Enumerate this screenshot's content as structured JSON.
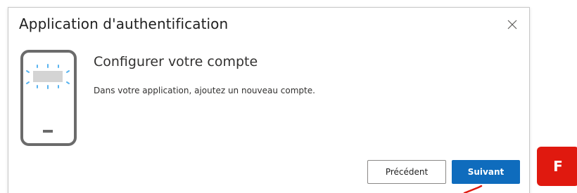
{
  "dialog": {
    "title": "Application d'authentification",
    "close_icon": "close-icon",
    "heading": "Configurer votre compte",
    "description": "Dans votre application, ajoutez un nouveau compte.",
    "phone_icon": "phone-illustration-icon"
  },
  "buttons": {
    "back_label": "Précédent",
    "next_label": "Suivant"
  },
  "annotation": {
    "badge_label": "F",
    "badge_color": "#e0190f",
    "arrow_color": "#e0190f"
  },
  "colors": {
    "primary": "#0f6cbd",
    "text": "#323130",
    "border": "#c8c8c8"
  }
}
